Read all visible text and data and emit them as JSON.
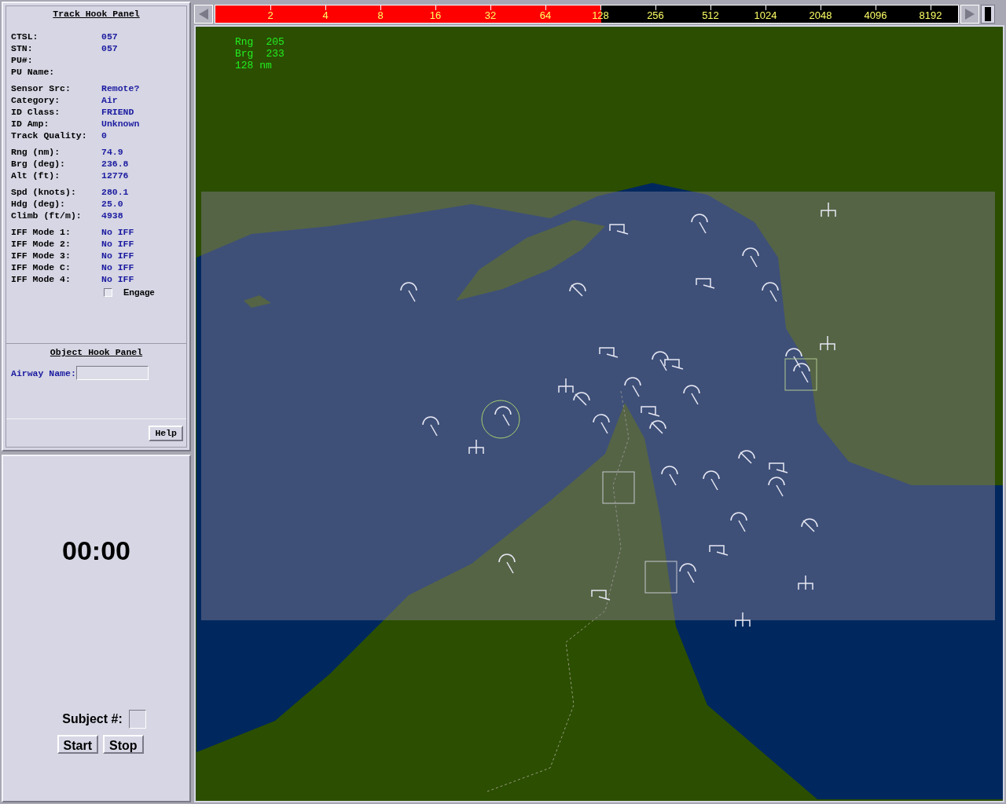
{
  "track_hook_panel": {
    "title": "Track Hook Panel",
    "groups": [
      [
        {
          "label": "CTSL:",
          "value": "057"
        },
        {
          "label": "STN:",
          "value": "057"
        },
        {
          "label": "PU#:"
        },
        {
          "label": "PU Name:"
        }
      ],
      [
        {
          "label": "Sensor Src:",
          "value": "Remote?"
        },
        {
          "label": "Category:",
          "value": "Air"
        },
        {
          "label": "ID Class:",
          "value": "FRIEND"
        },
        {
          "label": "ID Amp:",
          "value": "Unknown"
        },
        {
          "label": "Track Quality:",
          "value": "0"
        }
      ],
      [
        {
          "label": "Rng (nm):",
          "value": "74.9"
        },
        {
          "label": "Brg (deg):",
          "value": "236.8"
        },
        {
          "label": "Alt (ft):",
          "value": "12776"
        }
      ],
      [
        {
          "label": "Spd (knots):",
          "value": "280.1"
        },
        {
          "label": "Hdg (deg):",
          "value": "25.0"
        },
        {
          "label": "Climb (ft/m):",
          "value": "4938"
        }
      ],
      [
        {
          "label": "IFF Mode 1:",
          "value": "No IFF"
        },
        {
          "label": "IFF Mode 2:",
          "value": "No IFF"
        },
        {
          "label": "IFF Mode 3:",
          "value": "No IFF"
        },
        {
          "label": "IFF Mode C:",
          "value": "No IFF"
        },
        {
          "label": "IFF Mode 4:",
          "value": "No IFF"
        }
      ]
    ],
    "engage": {
      "label": "Engage",
      "checked": false
    }
  },
  "object_hook_panel": {
    "title": "Object Hook Panel",
    "airway_name_label": "Airway Name:"
  },
  "help_button": "Help",
  "timer": {
    "time": "00:00",
    "subject_label": "Subject #:",
    "buttons": [
      "Start",
      "Stop"
    ]
  },
  "range_scale": {
    "ticks": [
      "2",
      "4",
      "8",
      "16",
      "32",
      "64",
      "128",
      "256",
      "512",
      "1024",
      "2048",
      "4096",
      "8192"
    ],
    "level": 0.52
  },
  "map": {
    "readout": [
      {
        "label": "Rng",
        "value": "205"
      },
      {
        "label": "Brg",
        "value": "233"
      },
      {
        "label": "128 nm"
      }
    ]
  }
}
